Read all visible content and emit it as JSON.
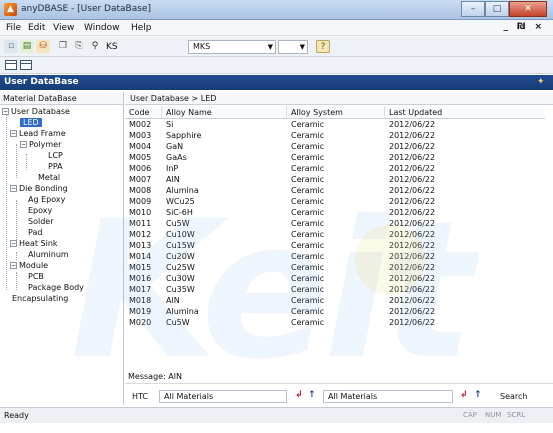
{
  "window": {
    "title": "anyDBASE - [User DataBase]",
    "minimize": "–",
    "maximize": "□",
    "close": "✕",
    "mdi_controls": "_ ₪ ×"
  },
  "menu": [
    "File",
    "Edit",
    "View",
    "Window",
    "Help"
  ],
  "toolbar": {
    "unit_label": "KS",
    "unit_system": "MKS",
    "combo2_value": "",
    "help_icon": "?"
  },
  "header": {
    "title": "User DataBase"
  },
  "tree": {
    "title": "Material DataBase",
    "nodes": [
      {
        "label": "User Database"
      },
      {
        "label": "LED"
      },
      {
        "label": "Lead Frame"
      },
      {
        "label": "Polymer"
      },
      {
        "label": "LCP"
      },
      {
        "label": "PPA"
      },
      {
        "label": "Metal"
      },
      {
        "label": "Die Bonding"
      },
      {
        "label": "Ag Epoxy"
      },
      {
        "label": "Epoxy"
      },
      {
        "label": "Solder"
      },
      {
        "label": "Pad"
      },
      {
        "label": "Heat Sink"
      },
      {
        "label": "Aluminum"
      },
      {
        "label": "Module"
      },
      {
        "label": "PCB"
      },
      {
        "label": "Package Body"
      },
      {
        "label": "Encapsulating"
      }
    ]
  },
  "table": {
    "breadcrumb": "User Database > LED",
    "columns": [
      "Code",
      "Alloy Name",
      "Alloy System",
      "Last Updated"
    ],
    "rows": [
      {
        "code": "M002",
        "name": "Si",
        "system": "Ceramic",
        "updated": "2012/06/22"
      },
      {
        "code": "M003",
        "name": "Sapphire",
        "system": "Ceramic",
        "updated": "2012/06/22"
      },
      {
        "code": "M004",
        "name": "GaN",
        "system": "Ceramic",
        "updated": "2012/06/22"
      },
      {
        "code": "M005",
        "name": "GaAs",
        "system": "Ceramic",
        "updated": "2012/06/22"
      },
      {
        "code": "M006",
        "name": "InP",
        "system": "Ceramic",
        "updated": "2012/06/22"
      },
      {
        "code": "M007",
        "name": "AlN",
        "system": "Ceramic",
        "updated": "2012/06/22"
      },
      {
        "code": "M008",
        "name": "Alumina",
        "system": "Ceramic",
        "updated": "2012/06/22"
      },
      {
        "code": "M009",
        "name": "WCu25",
        "system": "Ceramic",
        "updated": "2012/06/22"
      },
      {
        "code": "M010",
        "name": "SiC-6H",
        "system": "Ceramic",
        "updated": "2012/06/22"
      },
      {
        "code": "M011",
        "name": "Cu5W",
        "system": "Ceramic",
        "updated": "2012/06/22"
      },
      {
        "code": "M012",
        "name": "Cu10W",
        "system": "Ceramic",
        "updated": "2012/06/22"
      },
      {
        "code": "M013",
        "name": "Cu15W",
        "system": "Ceramic",
        "updated": "2012/06/22"
      },
      {
        "code": "M014",
        "name": "Cu20W",
        "system": "Ceramic",
        "updated": "2012/06/22"
      },
      {
        "code": "M015",
        "name": "Cu25W",
        "system": "Ceramic",
        "updated": "2012/06/22"
      },
      {
        "code": "M016",
        "name": "Cu30W",
        "system": "Ceramic",
        "updated": "2012/06/22"
      },
      {
        "code": "M017",
        "name": "Cu35W",
        "system": "Ceramic",
        "updated": "2012/06/22"
      },
      {
        "code": "M018",
        "name": "AlN",
        "system": "Ceramic",
        "updated": "2012/06/22"
      },
      {
        "code": "M019",
        "name": "Alumina",
        "system": "Ceramic",
        "updated": "2012/06/22"
      },
      {
        "code": "M020",
        "name": "Cu5W",
        "system": "Ceramic",
        "updated": "2012/06/22"
      }
    ]
  },
  "message": "Message: AlN",
  "filter": {
    "label": "HTC",
    "left_value": "All Materials",
    "right_value": "All Materials",
    "search_label": "Search"
  },
  "watermark": "Keit",
  "status": {
    "text": "Ready",
    "indicators": [
      "CAP",
      "NUM",
      "SCRL"
    ]
  },
  "colors": {
    "header_bg": "#1f4c8f",
    "selection": "#2f6cc9",
    "arrow_red": "#c8102e",
    "arrow_blue": "#1d3f9a"
  }
}
